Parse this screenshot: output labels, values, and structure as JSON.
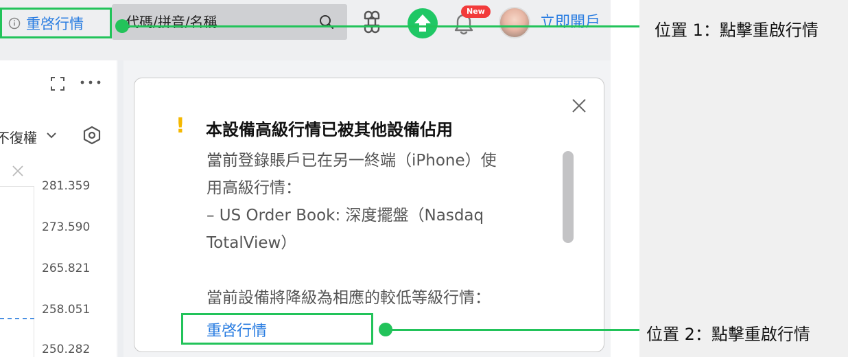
{
  "topbar": {
    "restart_label": "重啓行情",
    "search_placeholder": "代碼/拼音/名稱",
    "new_badge": "New",
    "open_account": "立即開戶"
  },
  "chart_panel": {
    "adjust_label": "不復權",
    "price_ticks": [
      "281.359",
      "273.590",
      "265.821",
      "258.051",
      "250.282"
    ]
  },
  "dialog": {
    "title": "本設備高級行情已被其他設備佔用",
    "body_lines": [
      "當前登錄賬戶已在另一終端（iPhone）使",
      "用高級行情：",
      "– US Order Book: 深度擺盤（Nasdaq",
      "TotalView）",
      "當前設備將降級為相應的較低等級行情："
    ],
    "restart_label": "重啓行情"
  },
  "annotations": {
    "pos1": "位置 1：點擊重啟行情",
    "pos2": "位置 2：點擊重啟行情"
  },
  "colors": {
    "accent_blue": "#2a7de1",
    "annotation_green": "#22c35a",
    "warning_yellow": "#f5b800",
    "badge_red": "#f23b3b"
  }
}
